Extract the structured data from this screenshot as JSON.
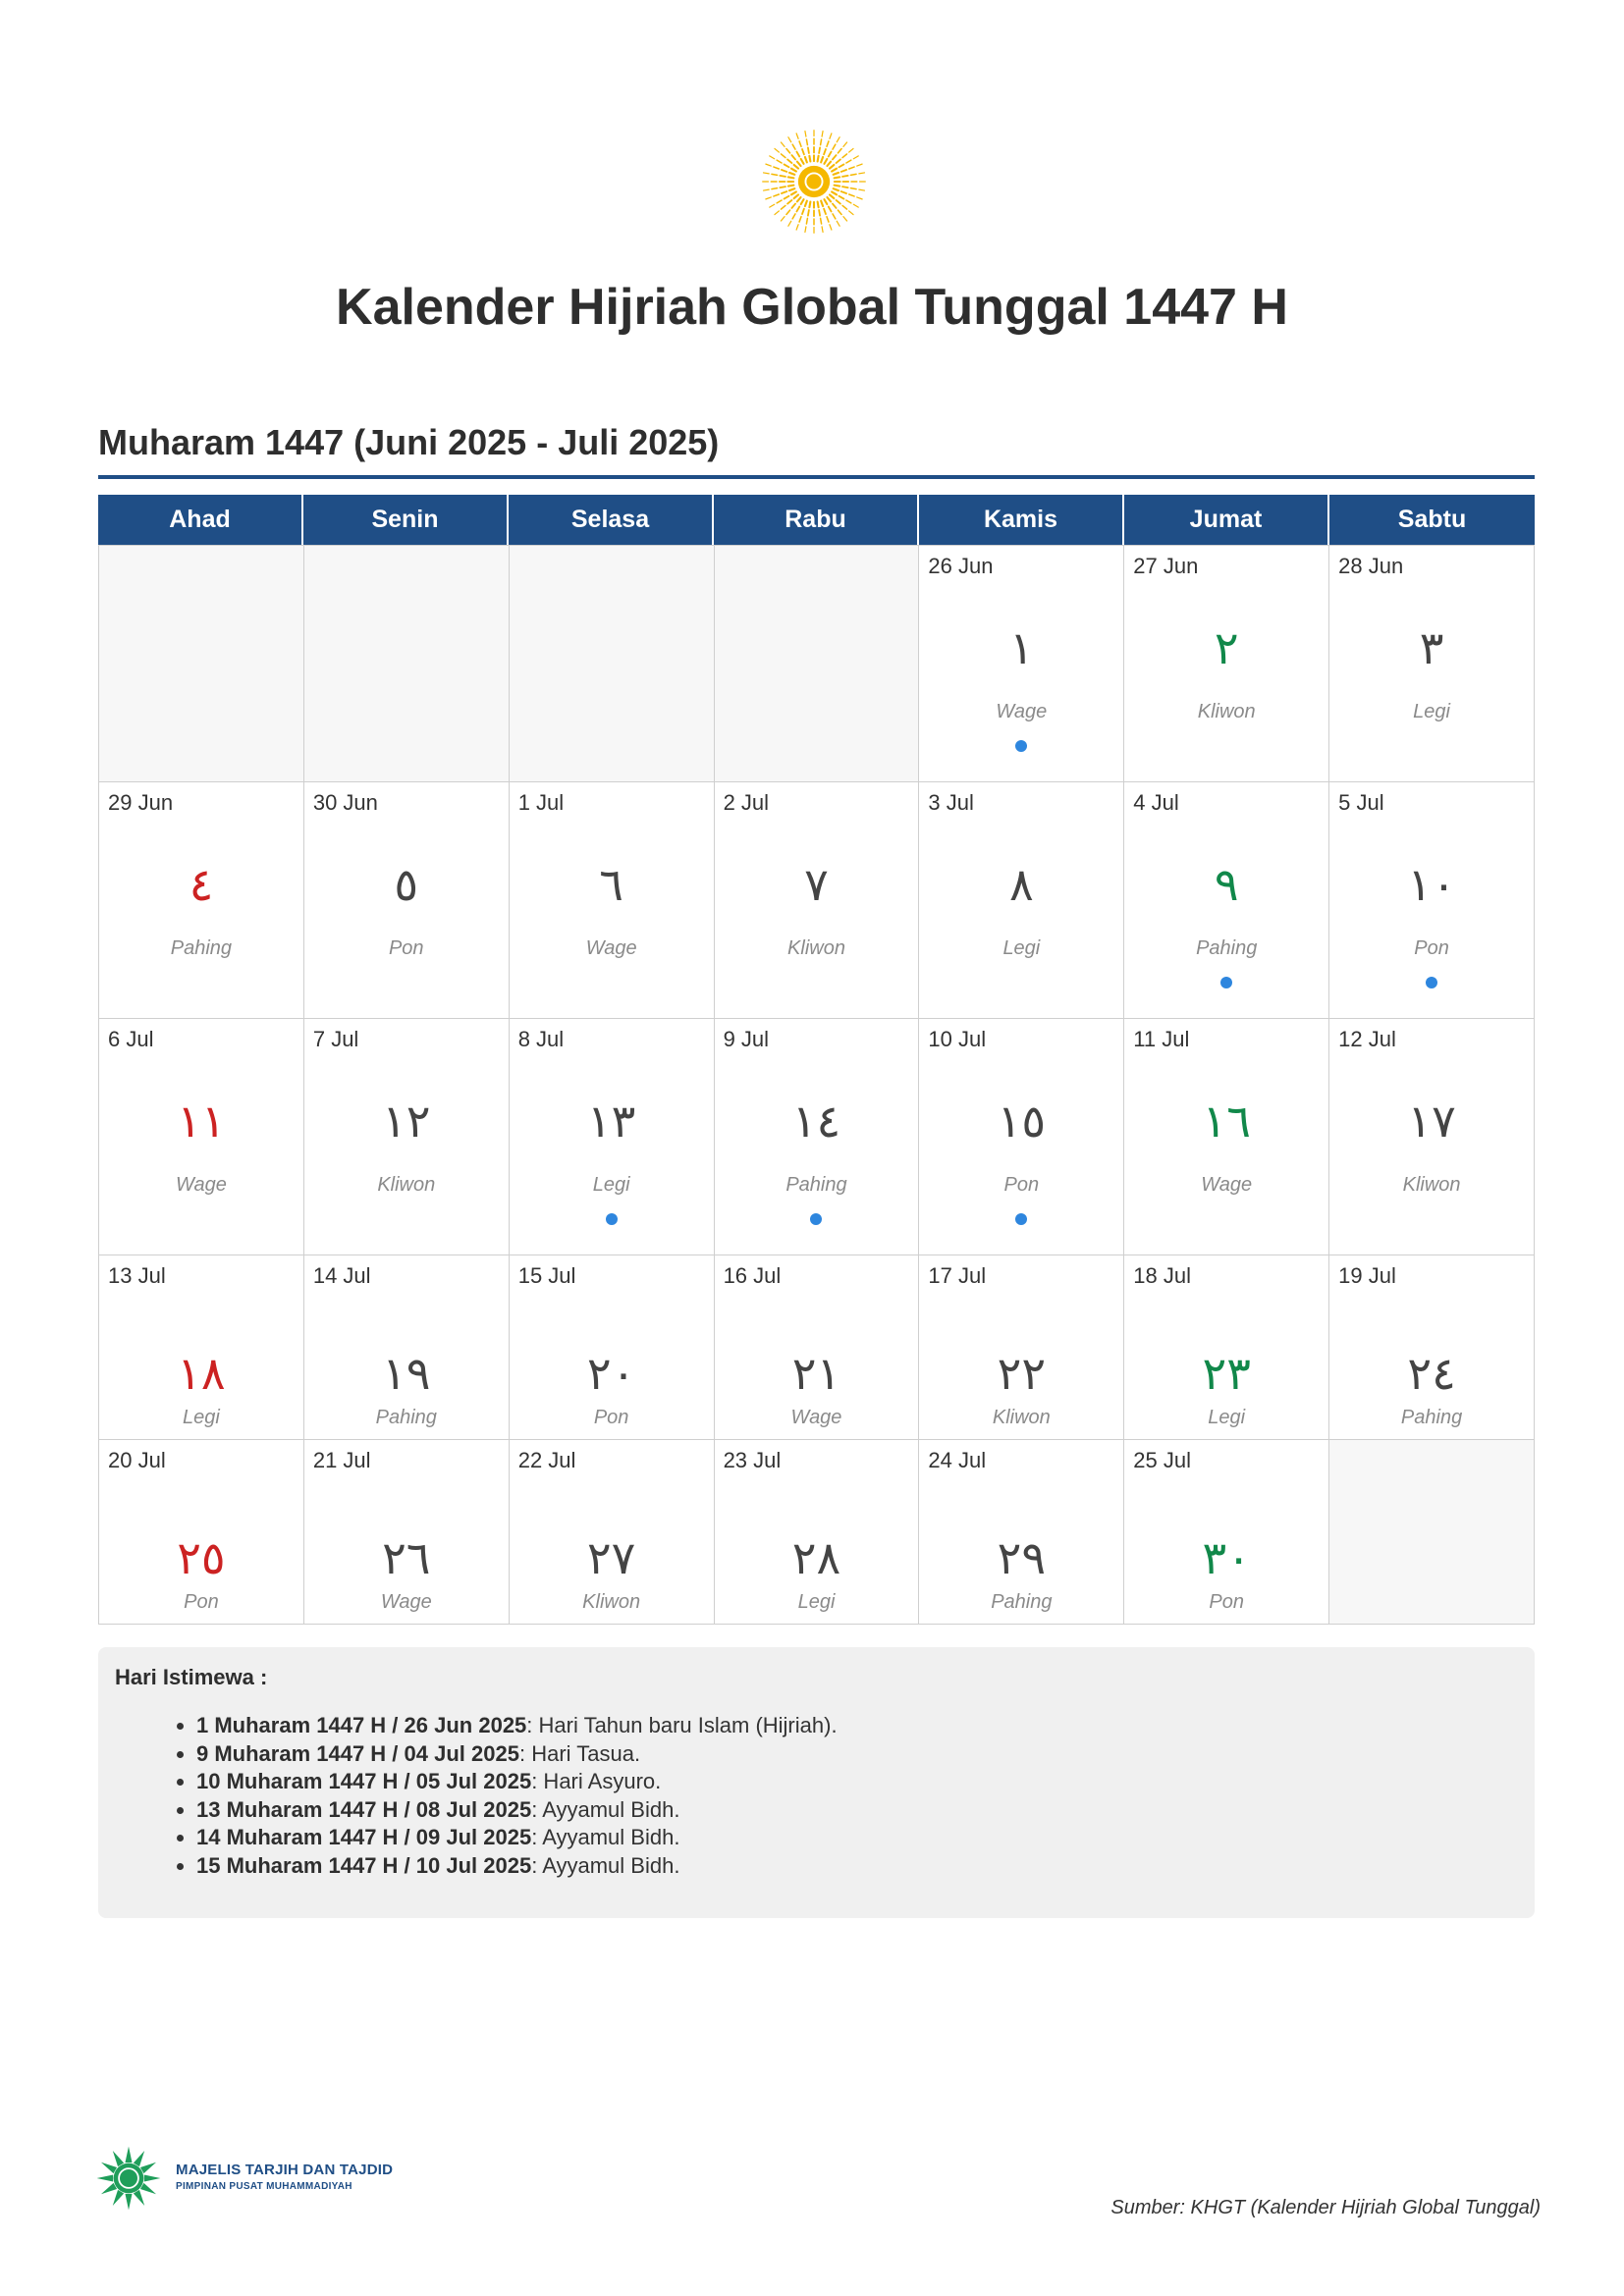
{
  "colors": {
    "accent": "#1f4e86",
    "sun": "#f5b800",
    "hijri_default": "#444444",
    "hijri_sunday": "#cc2222",
    "hijri_friday": "#11884a",
    "event_dot": "#2e86de",
    "logo_green": "#1f9e5a"
  },
  "icons": {
    "header_logo": "sun-icon",
    "footer_logo": "muhammadiyah-sun-icon"
  },
  "title": "Kalender Hijriah Global Tunggal 1447 H",
  "month_title": "Muharam 1447 (Juni 2025 - Juli 2025)",
  "weekdays": [
    "Ahad",
    "Senin",
    "Selasa",
    "Rabu",
    "Kamis",
    "Jumat",
    "Sabtu"
  ],
  "weeks": [
    [
      null,
      null,
      null,
      null,
      {
        "greg": "26 Jun",
        "hijri": "١",
        "pasaran": "Wage",
        "dot": true
      },
      {
        "greg": "27 Jun",
        "hijri": "٢",
        "pasaran": "Kliwon",
        "dot": false
      },
      {
        "greg": "28 Jun",
        "hijri": "٣",
        "pasaran": "Legi",
        "dot": false
      }
    ],
    [
      {
        "greg": "29 Jun",
        "hijri": "٤",
        "pasaran": "Pahing",
        "dot": false
      },
      {
        "greg": "30 Jun",
        "hijri": "٥",
        "pasaran": "Pon",
        "dot": false
      },
      {
        "greg": "1 Jul",
        "hijri": "٦",
        "pasaran": "Wage",
        "dot": false
      },
      {
        "greg": "2 Jul",
        "hijri": "٧",
        "pasaran": "Kliwon",
        "dot": false
      },
      {
        "greg": "3 Jul",
        "hijri": "٨",
        "pasaran": "Legi",
        "dot": false
      },
      {
        "greg": "4 Jul",
        "hijri": "٩",
        "pasaran": "Pahing",
        "dot": true
      },
      {
        "greg": "5 Jul",
        "hijri": "١٠",
        "pasaran": "Pon",
        "dot": true
      }
    ],
    [
      {
        "greg": "6 Jul",
        "hijri": "١١",
        "pasaran": "Wage",
        "dot": false
      },
      {
        "greg": "7 Jul",
        "hijri": "١٢",
        "pasaran": "Kliwon",
        "dot": false
      },
      {
        "greg": "8 Jul",
        "hijri": "١٣",
        "pasaran": "Legi",
        "dot": true
      },
      {
        "greg": "9 Jul",
        "hijri": "١٤",
        "pasaran": "Pahing",
        "dot": true
      },
      {
        "greg": "10 Jul",
        "hijri": "١٥",
        "pasaran": "Pon",
        "dot": true
      },
      {
        "greg": "11 Jul",
        "hijri": "١٦",
        "pasaran": "Wage",
        "dot": false
      },
      {
        "greg": "12 Jul",
        "hijri": "١٧",
        "pasaran": "Kliwon",
        "dot": false
      }
    ],
    [
      {
        "greg": "13 Jul",
        "hijri": "١٨",
        "pasaran": "Legi",
        "dot": false
      },
      {
        "greg": "14 Jul",
        "hijri": "١٩",
        "pasaran": "Pahing",
        "dot": false
      },
      {
        "greg": "15 Jul",
        "hijri": "٢٠",
        "pasaran": "Pon",
        "dot": false
      },
      {
        "greg": "16 Jul",
        "hijri": "٢١",
        "pasaran": "Wage",
        "dot": false
      },
      {
        "greg": "17 Jul",
        "hijri": "٢٢",
        "pasaran": "Kliwon",
        "dot": false
      },
      {
        "greg": "18 Jul",
        "hijri": "٢٣",
        "pasaran": "Legi",
        "dot": false
      },
      {
        "greg": "19 Jul",
        "hijri": "٢٤",
        "pasaran": "Pahing",
        "dot": false
      }
    ],
    [
      {
        "greg": "20 Jul",
        "hijri": "٢٥",
        "pasaran": "Pon",
        "dot": false
      },
      {
        "greg": "21 Jul",
        "hijri": "٢٦",
        "pasaran": "Wage",
        "dot": false
      },
      {
        "greg": "22 Jul",
        "hijri": "٢٧",
        "pasaran": "Kliwon",
        "dot": false
      },
      {
        "greg": "23 Jul",
        "hijri": "٢٨",
        "pasaran": "Legi",
        "dot": false
      },
      {
        "greg": "24 Jul",
        "hijri": "٢٩",
        "pasaran": "Pahing",
        "dot": false
      },
      {
        "greg": "25 Jul",
        "hijri": "٣٠",
        "pasaran": "Pon",
        "dot": false
      },
      null
    ]
  ],
  "special_days": {
    "title": "Hari Istimewa :",
    "items": [
      {
        "date": "1 Muharam 1447 H / 26 Jun 2025",
        "desc": ": Hari Tahun baru Islam (Hijriah)."
      },
      {
        "date": "9 Muharam 1447 H / 04 Jul 2025",
        "desc": ": Hari Tasua."
      },
      {
        "date": "10 Muharam 1447 H / 05 Jul 2025",
        "desc": ": Hari Asyuro."
      },
      {
        "date": "13 Muharam 1447 H / 08 Jul 2025",
        "desc": ": Ayyamul Bidh."
      },
      {
        "date": "14 Muharam 1447 H / 09 Jul 2025",
        "desc": ": Ayyamul Bidh."
      },
      {
        "date": "15 Muharam 1447 H / 10 Jul 2025",
        "desc": ": Ayyamul Bidh."
      }
    ]
  },
  "footer": {
    "org_name": "MAJELIS TARJIH DAN TAJDID",
    "org_sub": "PIMPINAN PUSAT MUHAMMADIYAH",
    "source": "Sumber: KHGT (Kalender Hijriah Global Tunggal)"
  }
}
